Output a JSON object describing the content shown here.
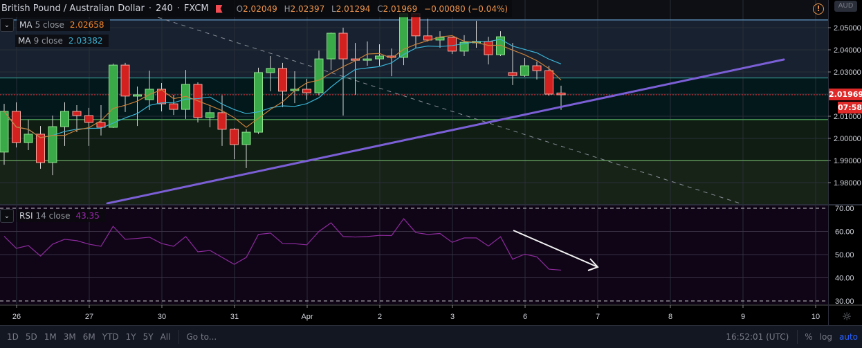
{
  "header": {
    "symbol": "British Pound / Australian Dollar",
    "interval": "240",
    "exchange": "FXCM",
    "open_label": "O",
    "open": "2.02049",
    "high_label": "H",
    "high": "2.02397",
    "low_label": "L",
    "low": "2.01294",
    "close_label": "C",
    "close": "2.01969",
    "change": "−0.00080 (−0.04%)"
  },
  "legend": {
    "ma5": {
      "name": "MA",
      "params": "5 close",
      "value": "2.02658",
      "color": "#f5862b"
    },
    "ma9": {
      "name": "MA",
      "params": "9 close",
      "value": "2.03382",
      "color": "#3bb3d6"
    },
    "rsi": {
      "name": "RSI",
      "params": "14 close",
      "value": "43.35",
      "color": "#9c27b0"
    }
  },
  "currency_button": "AUD",
  "price_axis": {
    "ticks": [
      "2.05000",
      "2.04000",
      "2.03000",
      "2.01000",
      "2.00000",
      "1.99000",
      "1.98000"
    ],
    "current_price": "2.01969",
    "countdown": "07:58"
  },
  "rsi_axis": {
    "ticks": [
      "70.00",
      "60.00",
      "50.00",
      "40.00",
      "30.00"
    ]
  },
  "time_axis": {
    "labels": [
      "26",
      "27",
      "30",
      "31",
      "Apr",
      "2",
      "3",
      "6",
      "7",
      "8",
      "9",
      "10"
    ]
  },
  "toolbar": {
    "ranges": [
      "1D",
      "5D",
      "1M",
      "3M",
      "6M",
      "YTD",
      "1Y",
      "5Y",
      "All"
    ],
    "goto": "Go to...",
    "clock": "16:52:01 (UTC)",
    "percent": "%",
    "log": "log",
    "auto": "auto"
  },
  "colors": {
    "up": "#3aaa48",
    "down": "#d3211f",
    "trendline": "#7b5fd6",
    "rsi": "#8e2a9c"
  },
  "chart_data": {
    "type": "candlestick",
    "title": "British Pound / Australian Dollar 240 FXCM",
    "ylim": [
      1.9706,
      2.0625
    ],
    "candles_ohlc": [
      [
        1.9938,
        2.0156,
        1.9881,
        2.0122
      ],
      [
        2.0122,
        2.0163,
        1.9959,
        1.9981
      ],
      [
        1.9981,
        2.0084,
        1.9947,
        2.0019
      ],
      [
        2.0019,
        2.0056,
        1.9863,
        1.9891
      ],
      [
        1.9891,
        2.0103,
        1.9834,
        2.0053
      ],
      [
        2.0053,
        2.0163,
        1.9966,
        2.0122
      ],
      [
        2.0122,
        2.015,
        2.0028,
        2.0103
      ],
      [
        2.0103,
        2.0138,
        1.9966,
        2.0072
      ],
      [
        2.0072,
        2.015,
        2.0013,
        2.005
      ],
      [
        2.005,
        2.0338,
        2.0047,
        2.0331
      ],
      [
        2.0331,
        2.0341,
        2.0119,
        2.0191
      ],
      [
        2.0191,
        2.0234,
        2.0056,
        2.0197
      ],
      [
        2.0175,
        2.0306,
        2.0128,
        2.0222
      ],
      [
        2.0222,
        2.025,
        2.0122,
        2.0156
      ],
      [
        2.0156,
        2.0197,
        2.0106,
        2.0131
      ],
      [
        2.0131,
        2.0309,
        2.0088,
        2.0244
      ],
      [
        2.0244,
        2.0253,
        2.0072,
        2.0094
      ],
      [
        2.0094,
        2.0144,
        2.005,
        2.0116
      ],
      [
        2.0116,
        2.0194,
        1.9966,
        2.0041
      ],
      [
        2.0041,
        2.0047,
        1.9906,
        1.9972
      ],
      [
        1.9972,
        2.0041,
        1.9866,
        2.0028
      ],
      [
        2.0028,
        2.0319,
        2.002,
        2.0297
      ],
      [
        2.0297,
        2.0372,
        2.0213,
        2.0316
      ],
      [
        2.0316,
        2.0341,
        2.0141,
        2.0213
      ],
      [
        2.0216,
        2.0303,
        2.0159,
        2.0222
      ],
      [
        2.0222,
        2.0269,
        2.0175,
        2.0206
      ],
      [
        2.0206,
        2.0397,
        2.0194,
        2.0359
      ],
      [
        2.0359,
        2.0478,
        2.0309,
        2.0475
      ],
      [
        2.0475,
        2.05,
        2.0103,
        2.0359
      ],
      [
        2.0359,
        2.0431,
        2.0197,
        2.0353
      ],
      [
        2.0353,
        2.0438,
        2.0328,
        2.0359
      ],
      [
        2.0359,
        2.0425,
        2.0328,
        2.0372
      ],
      [
        2.0372,
        2.0406,
        2.0281,
        2.0366
      ],
      [
        2.0366,
        2.0563,
        2.0331,
        2.0563
      ],
      [
        2.0563,
        2.0563,
        2.0409,
        2.0463
      ],
      [
        2.0463,
        2.0541,
        2.0438,
        2.0444
      ],
      [
        2.0444,
        2.0484,
        2.0409,
        2.0456
      ],
      [
        2.0456,
        2.0459,
        2.0381,
        2.0394
      ],
      [
        2.0394,
        2.0466,
        2.0372,
        2.0434
      ],
      [
        2.0434,
        2.0531,
        2.0409,
        2.0438
      ],
      [
        2.0438,
        2.0459,
        2.0334,
        2.0378
      ],
      [
        2.0378,
        2.0484,
        2.0372,
        2.0459
      ],
      [
        2.0297,
        2.0431,
        2.0241,
        2.0284
      ],
      [
        2.0284,
        2.0363,
        2.0278,
        2.0328
      ],
      [
        2.0328,
        2.0347,
        2.0266,
        2.0306
      ],
      [
        2.0306,
        2.0328,
        2.0191,
        2.02
      ],
      [
        2.0205,
        2.0238,
        2.0129,
        2.0197
      ]
    ],
    "rsi": [
      57.9,
      52.7,
      53.9,
      49.4,
      54.5,
      56.6,
      56.0,
      54.5,
      53.6,
      62.2,
      56.6,
      57.0,
      57.5,
      54.8,
      53.6,
      57.8,
      51.2,
      51.8,
      48.8,
      45.8,
      48.8,
      58.7,
      59.3,
      54.8,
      54.7,
      54.2,
      60.0,
      63.7,
      57.8,
      57.6,
      57.8,
      58.3,
      58.2,
      65.5,
      59.5,
      58.7,
      59.1,
      55.3,
      57.2,
      57.2,
      53.7,
      57.7,
      48.0,
      50.2,
      49.0,
      43.7,
      43.3
    ],
    "rsi_levels": [
      70,
      30
    ],
    "zones": [
      2.0535,
      2.0273,
      2.0085,
      1.99
    ],
    "trendline_prices": [
      1.972,
      2.037
    ],
    "annotation": "RSI downward arrow"
  }
}
